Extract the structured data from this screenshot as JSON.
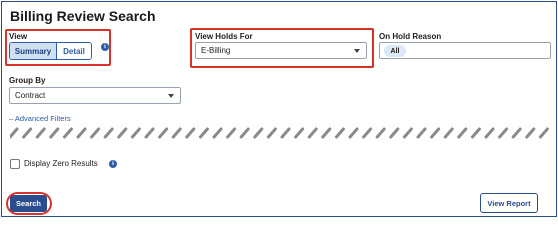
{
  "page": {
    "title": "Billing Review Search"
  },
  "view": {
    "label": "View",
    "options": [
      "Summary",
      "Detail"
    ],
    "selected": "Summary"
  },
  "holds": {
    "label": "View Holds For",
    "value": "E-Billing"
  },
  "on_hold": {
    "label": "On Hold Reason",
    "selected": [
      "All"
    ]
  },
  "group_by": {
    "label": "Group By",
    "value": "Contract"
  },
  "advanced": {
    "label": "Advanced Filters",
    "toggle_glyph": "–"
  },
  "zero": {
    "label": "Display Zero Results",
    "checked": false
  },
  "actions": {
    "search": "Search",
    "report": "View Report"
  },
  "colors": {
    "accent": "#2a4d8f",
    "highlight": "#d9312b",
    "pill": "#dbe8f6"
  },
  "icons": [
    "info-icon",
    "chevron-down-icon"
  ]
}
